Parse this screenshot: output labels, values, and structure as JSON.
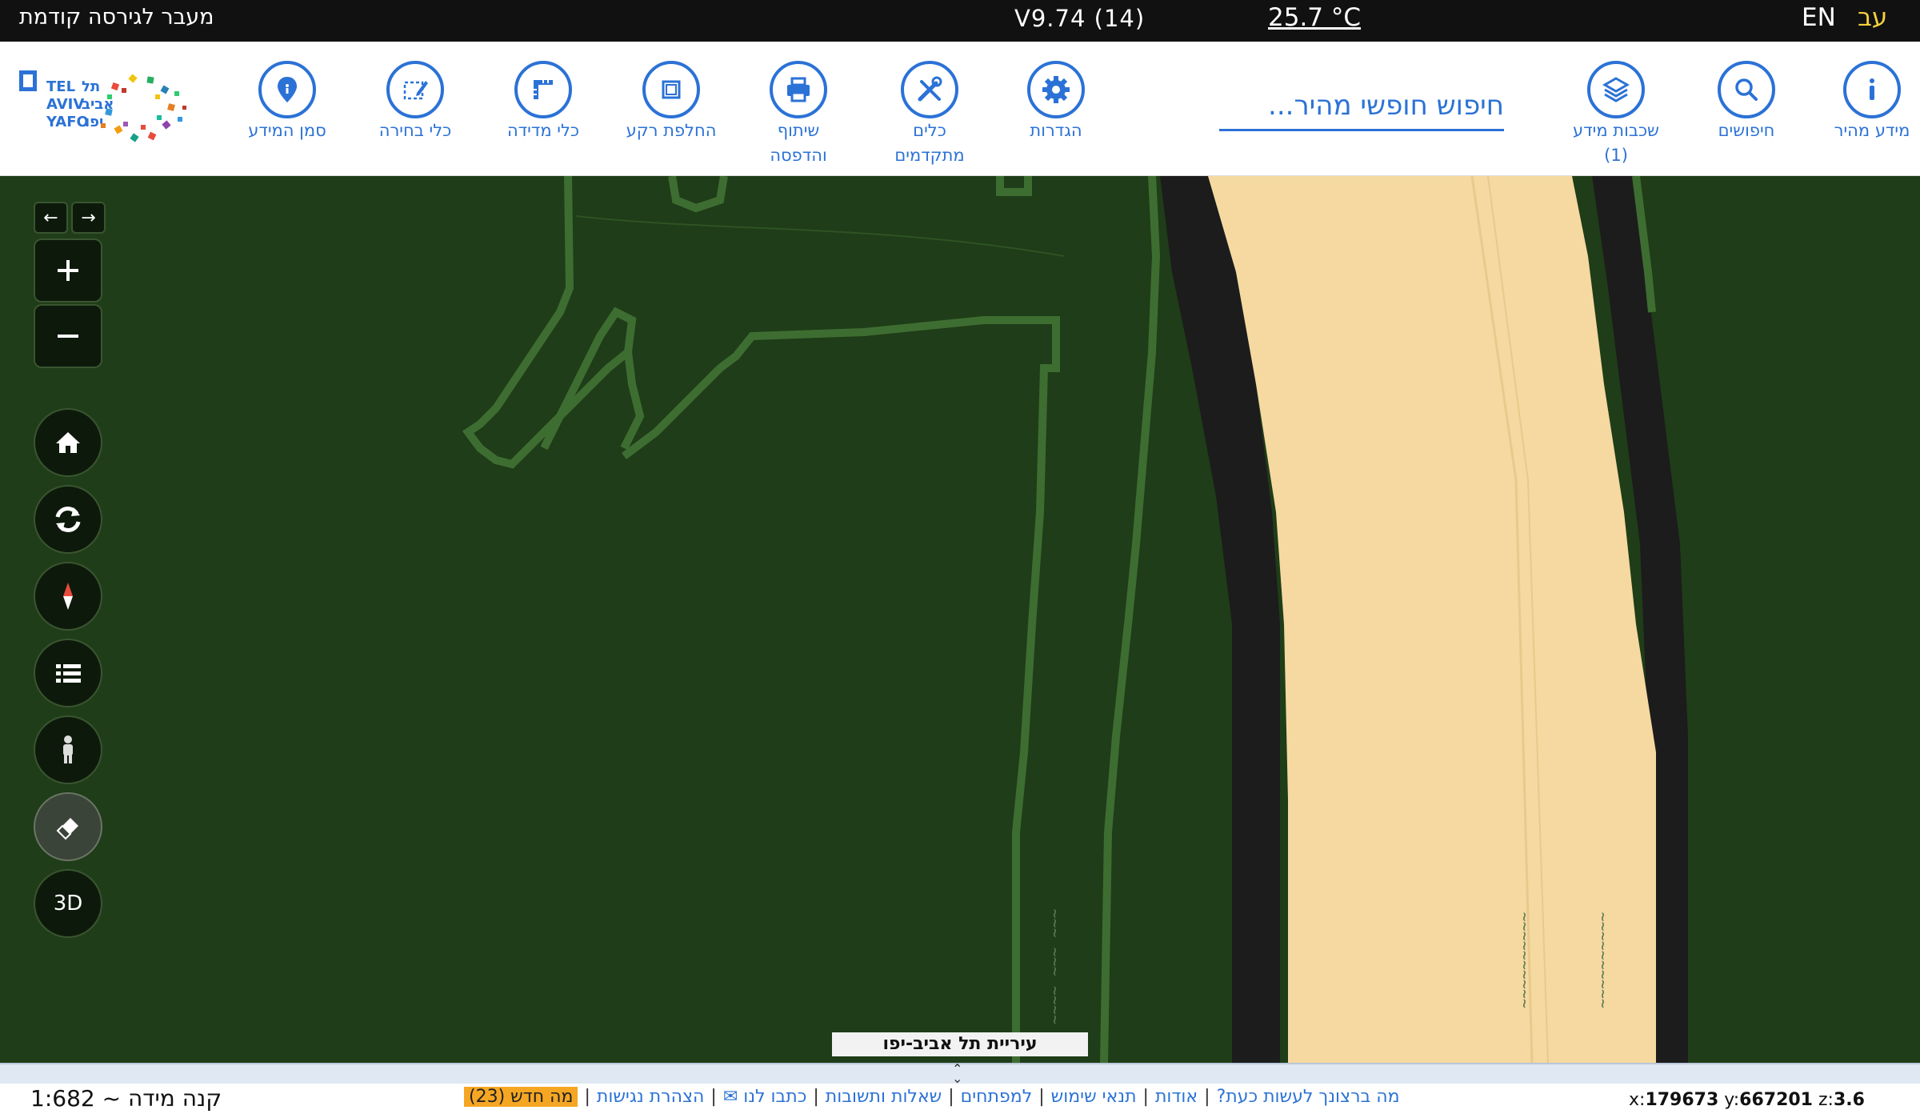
{
  "topbar": {
    "previous_version": "מעבר לגירסה קודמת",
    "version": "V9.74 (14)",
    "temperature": "25.7 °C",
    "lang_en": "EN",
    "lang_he": "עב"
  },
  "toolbar": {
    "items": [
      {
        "label": "מידע מהיר",
        "icon": "info-icon"
      },
      {
        "label": "חיפושים",
        "icon": "search-icon"
      },
      {
        "label": "שכבות מידע (1)",
        "icon": "layers-icon"
      },
      {
        "label": "הגדרות",
        "icon": "gear-icon"
      },
      {
        "label": "כלים מתקדמים",
        "icon": "tools-icon"
      },
      {
        "label": "שיתוף והדפסה",
        "icon": "print-icon"
      },
      {
        "label": "החלפת רקע",
        "icon": "basemap-icon"
      },
      {
        "label": "כלי מדידה",
        "icon": "ruler-icon"
      },
      {
        "label": "כלי בחירה",
        "icon": "select-icon"
      },
      {
        "label": "סמן המידע",
        "icon": "pin-icon"
      }
    ],
    "search_placeholder": "חיפוש חופשי מהיר...",
    "logo": {
      "line1": "תל",
      "line2": "אביב",
      "line3": "יפו",
      "en1": "TEL",
      "en2": "AVIV",
      "en3": "YAFO"
    }
  },
  "map": {
    "city_label": "עיריית תל אביב-יפו",
    "controls": {
      "three_d": "3D"
    }
  },
  "footer": {
    "scale": "קנה מידה ~ 1:682",
    "links": [
      "מה ברצונך לעשות כעת?",
      "אודות",
      "תנאי שימוש",
      "למפתחים",
      "שאלות ותשובות",
      "כתבו לנו ✉",
      "הצהרת נגישות"
    ],
    "whats_new": "מה חדש (23)",
    "coord_x_label": "x:",
    "coord_x": "179673",
    "coord_y_label": "y:",
    "coord_y": "667201",
    "coord_z_label": "z:",
    "coord_z": "3.6"
  },
  "colors": {
    "accent": "#2b72d6",
    "map_green": "#1f3d18",
    "road_sand": "#f5d9a0",
    "highlight": "#f5a623"
  }
}
